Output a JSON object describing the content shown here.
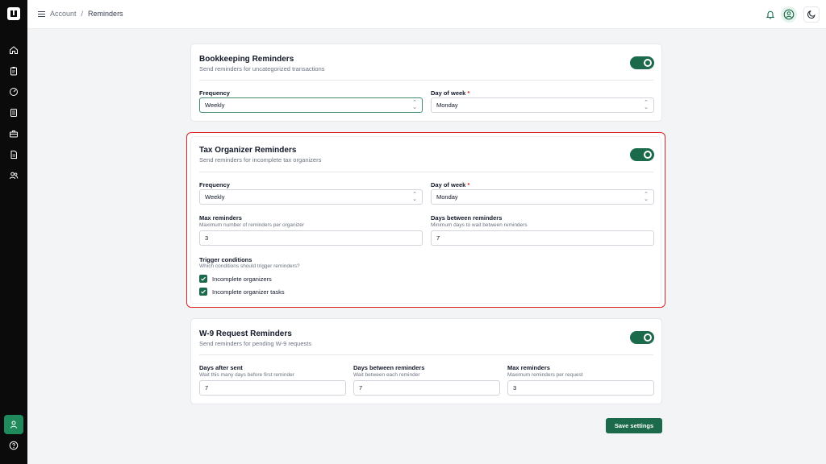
{
  "breadcrumb": {
    "parent": "Account",
    "separator": "/",
    "current": "Reminders"
  },
  "colors": {
    "accent": "#1b6a4b",
    "highlight": "#dc2626",
    "sidebar": "#0b0b0b"
  },
  "bookkeeping": {
    "title": "Bookkeeping Reminders",
    "subtitle": "Send reminders for uncategorized transactions",
    "frequency_label": "Frequency",
    "frequency_value": "Weekly",
    "day_label": "Day of week",
    "day_required": "*",
    "day_value": "Monday"
  },
  "tax": {
    "title": "Tax Organizer Reminders",
    "subtitle": "Send reminders for incomplete tax organizers",
    "frequency_label": "Frequency",
    "frequency_value": "Weekly",
    "day_label": "Day of week",
    "day_required": "*",
    "day_value": "Monday",
    "max_label": "Max reminders",
    "max_hint": "Maximum number of reminders per organizer",
    "max_value": "3",
    "between_label": "Days between reminders",
    "between_hint": "Minimum days to wait between reminders",
    "between_value": "7",
    "trigger_label": "Trigger conditions",
    "trigger_hint": "Which conditions should trigger reminders?",
    "conditions": [
      "Incomplete organizers",
      "Incomplete organizer tasks"
    ]
  },
  "w9": {
    "title": "W-9 Request Reminders",
    "subtitle": "Send reminders for pending W-9 requests",
    "after_label": "Days after sent",
    "after_hint": "Wait this many days before first reminder",
    "after_value": "7",
    "between_label": "Days between reminders",
    "between_hint": "Wait between each reminder",
    "between_value": "7",
    "max_label": "Max reminders",
    "max_hint": "Maximum reminders per request",
    "max_value": "3"
  },
  "save_label": "Save settings",
  "icons": {
    "sidebar": [
      "home-icon",
      "clipboard-icon",
      "gauge-icon",
      "list-icon",
      "briefcase-icon",
      "document-icon",
      "users-icon",
      "user-icon",
      "help-icon"
    ],
    "topbar": [
      "menu-icon",
      "bell-icon",
      "user-circle-icon",
      "moon-icon"
    ]
  }
}
